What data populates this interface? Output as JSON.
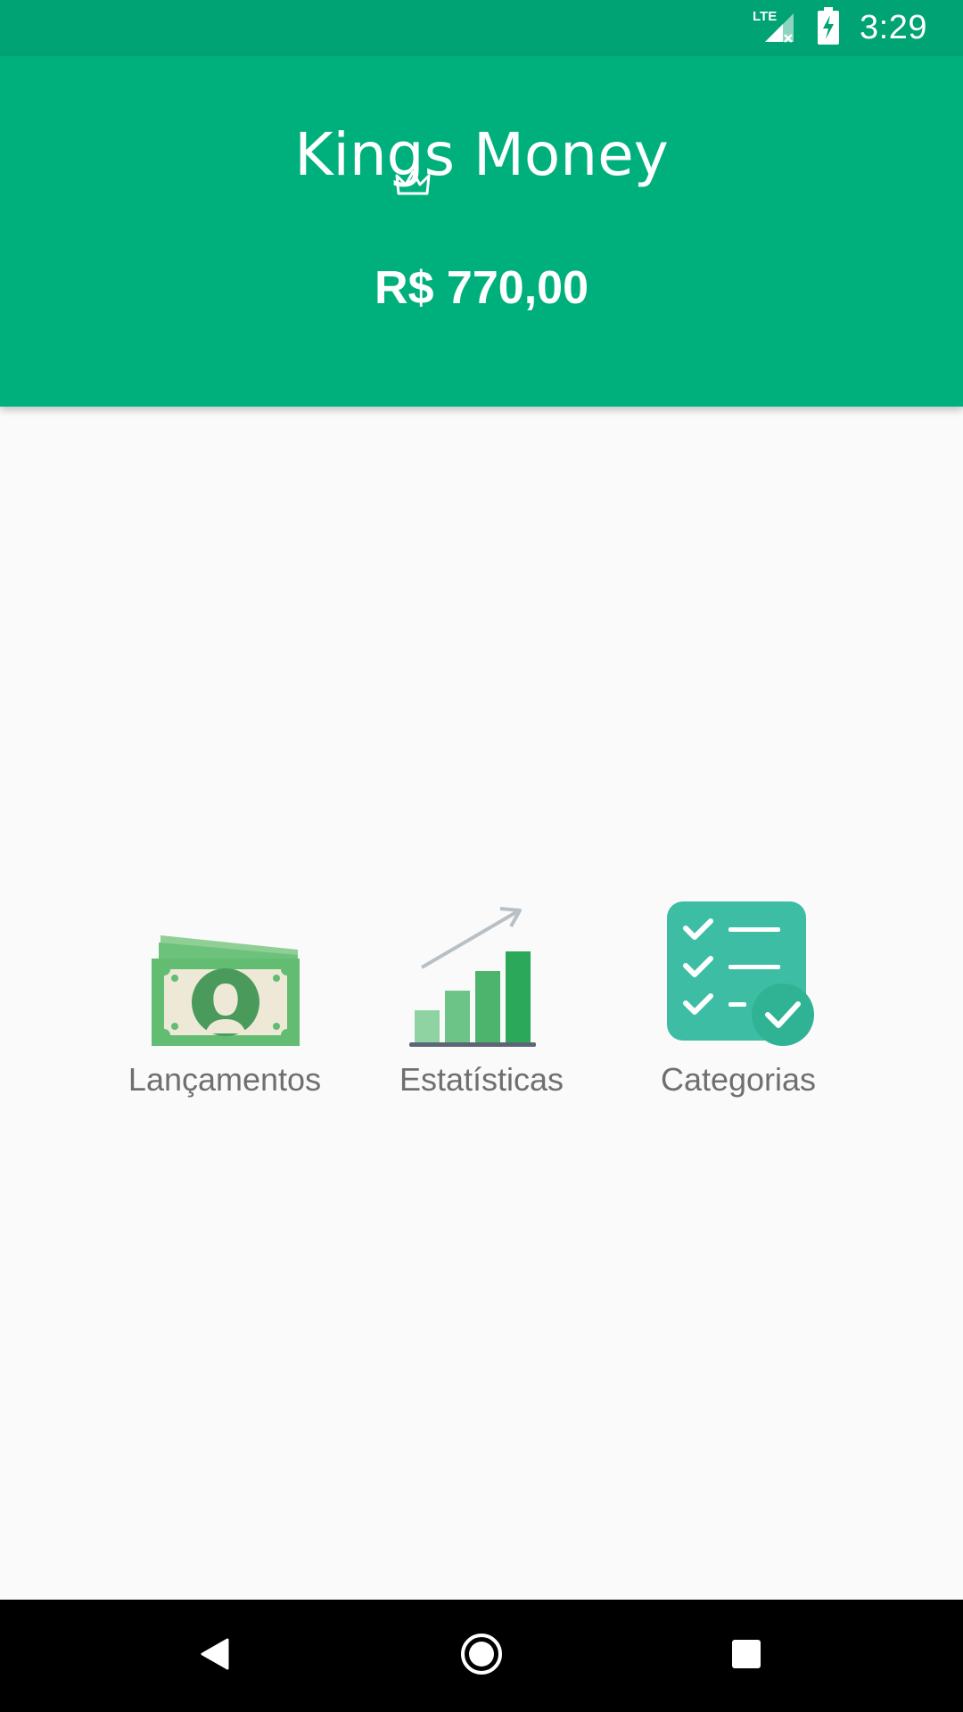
{
  "status_bar": {
    "network_label": "LTE",
    "time": "3:29"
  },
  "header": {
    "logo_text": "Kings Money",
    "balance": "R$ 770,00"
  },
  "menu": {
    "items": [
      {
        "label": "Lançamentos",
        "icon": "money-bills-icon"
      },
      {
        "label": "Estatísticas",
        "icon": "bar-chart-growth-icon"
      },
      {
        "label": "Categorias",
        "icon": "checklist-icon"
      }
    ]
  },
  "colors": {
    "status_bar": "#00a373",
    "header": "#00b07c",
    "background": "#fafafa",
    "label_text": "#6f6f6f",
    "nav_bar": "#000000"
  },
  "navigation": {
    "buttons": [
      "back-icon",
      "home-icon",
      "recents-icon"
    ]
  }
}
